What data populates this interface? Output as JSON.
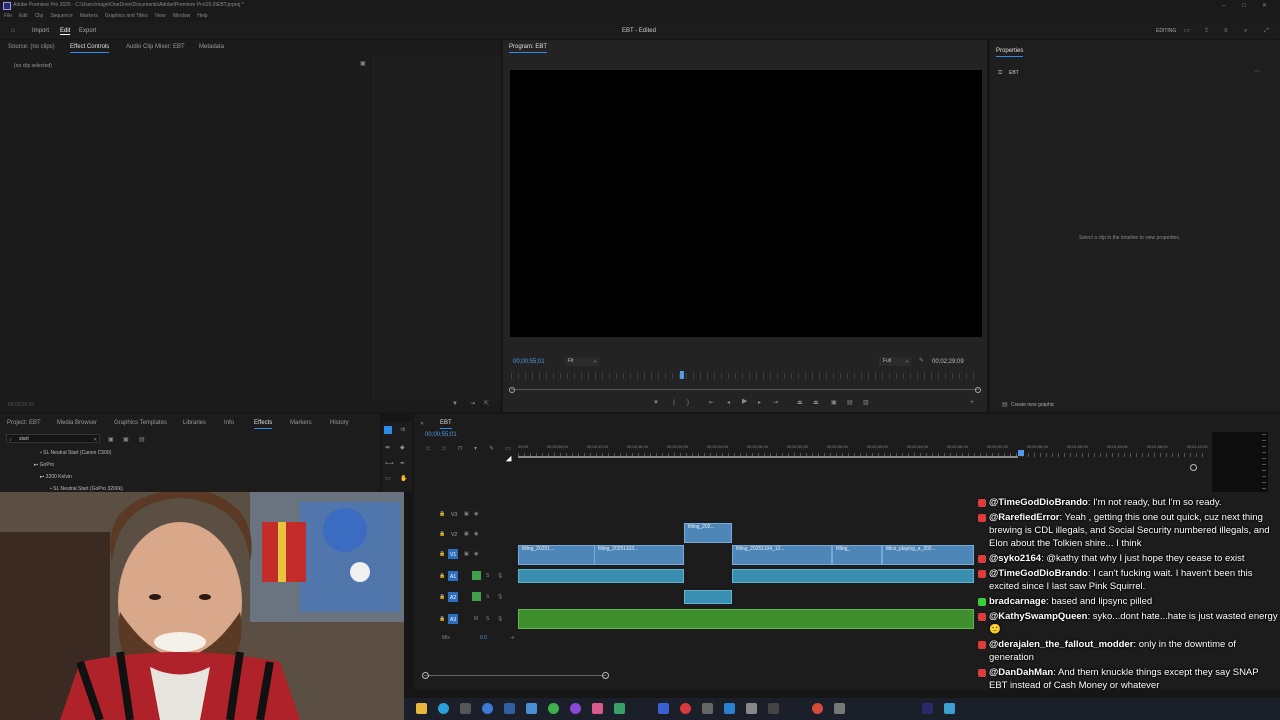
{
  "window": {
    "title": "Adobe Premiere Pro 2025 - C:\\Users\\mage\\OneDrive\\Documents\\Adobe\\Premiere Pro\\25.0\\EBT.prproj *",
    "menu": [
      "File",
      "Edit",
      "Clip",
      "Sequence",
      "Markers",
      "Graphics and Titles",
      "View",
      "Window",
      "Help"
    ]
  },
  "header": {
    "nav": [
      "Import",
      "Edit",
      "Export"
    ],
    "project_title": "EBT - Edited",
    "workspace": "EDITING"
  },
  "source_panel": {
    "tabs": [
      "Source: (no clips)",
      "Effect Controls",
      "Audio Clip Mixer: EBT",
      "Metadata"
    ],
    "no_clip": "(no clip selected)",
    "timecode": "00;00;55;01"
  },
  "program_monitor": {
    "tab": "Program: EBT",
    "timecode_in": "00;00;55;01",
    "fit": "Fit",
    "quality": "Full",
    "duration": "00;02;29;09"
  },
  "properties": {
    "tab": "Properties",
    "item": "EBT",
    "hint": "Select a clip in the timeline to view properties.",
    "create_graphic": "Create new graphic"
  },
  "project_panel": {
    "tabs": [
      "Project: EBT",
      "Media Browser",
      "Graphics Templates",
      "Libraries",
      "Info",
      "Effects",
      "Markers",
      "History"
    ],
    "search_value": "start",
    "tree": [
      "SL Neutral Start (Canon C500)",
      "GoPro",
      "3200 Kelvin",
      "SL Neutral Start (GoPro 3200k)"
    ]
  },
  "timeline": {
    "tab": "EBT",
    "timecode": "00;00;55;01",
    "ruler": [
      "00;00",
      "00;00;08;00",
      "00;00;12;00",
      "00;00;16;00",
      "00;00;20;00",
      "00;00;24;00",
      "00;00;28;00",
      "00;00;32;00",
      "00;00;36;00",
      "00;00;40;00",
      "00;00;44;00",
      "00;00;48;00",
      "00;00;52;00",
      "00;00;56;00",
      "00;01;00;00",
      "00;01;04;00",
      "00;01;08;00",
      "00;01;12;00"
    ],
    "tracks": [
      "V3",
      "V2",
      "V1",
      "A1",
      "A2",
      "A3",
      "Mix"
    ],
    "clips_v1": [
      "filling_20251...",
      "filling_20251103...",
      "filling_20251104_12...",
      "filling_",
      "Mics_playing_a_202..."
    ],
    "clip_v2": "filling_202..."
  },
  "chat": [
    {
      "user": "@TimeGodDioBrando",
      "text": "I'm not ready, but I'm so ready.",
      "badge_color": "#e03c3c"
    },
    {
      "user": "@RarefiedError",
      "text": "Yeah , getting this one out quick, cuz next thing brewing is CDL illegals, and Social Security numbered illegals, and Elon about the Tolkien shire... I think",
      "badge_color": "#e03c3c"
    },
    {
      "user": "@syko2164",
      "text": "@kathy that why I just hope they cease to exist",
      "badge_color": "#e03c3c"
    },
    {
      "user": "@TimeGodDioBrando",
      "text": "I can't fucking wait. I haven't been this excited since I last saw Pink Squirrel.",
      "badge_color": "#e03c3c"
    },
    {
      "user": "bradcarnage",
      "text": "based and lipsync pilled",
      "badge_color": "#3ccf3c"
    },
    {
      "user": "@KathySwampQueen",
      "text": "syko...dont hate...hate is just wasted energy 🙂",
      "badge_color": "#e03c3c"
    },
    {
      "user": "@derajalen_the_fallout_modder",
      "text": "only in the downtime of generation",
      "badge_color": "#e03c3c"
    },
    {
      "user": "@DanDahMan",
      "text": "And them knuckle things except they say SNAP EBT instead of Cash Money or whatever",
      "badge_color": "#e03c3c"
    }
  ],
  "colors": {
    "accent": "#2d8ceb",
    "video_clip": "#4f86b8",
    "audio_clip": "#3a8fb0",
    "audio_green": "#3f8f2e"
  }
}
